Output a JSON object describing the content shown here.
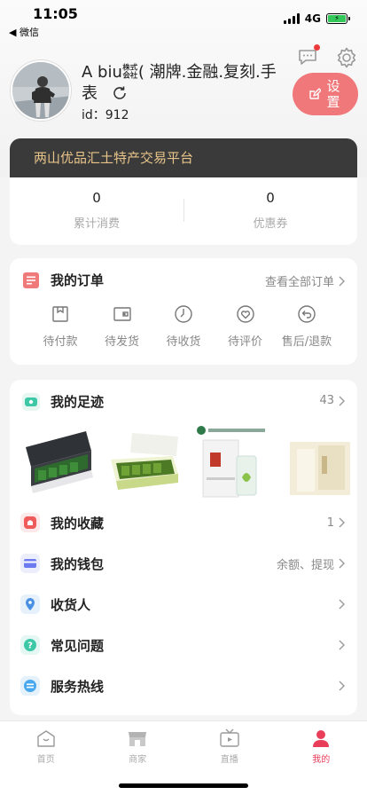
{
  "status": {
    "time": "11:05",
    "back_app": "◀ 微信",
    "network": "4G"
  },
  "profile": {
    "name": "A biu㍿( 潮牌.金融.复刻.手表",
    "id_label": "id：912",
    "settings_label": "设置"
  },
  "vip": {
    "banner": "两山优品汇土特产交易平台",
    "stats": [
      {
        "value": "0",
        "label": "累计消费"
      },
      {
        "value": "0",
        "label": "优惠券"
      }
    ]
  },
  "orders": {
    "title": "我的订单",
    "view_all": "查看全部订单",
    "items": [
      {
        "label": "待付款",
        "icon": "wallet-icon"
      },
      {
        "label": "待发货",
        "icon": "box-icon"
      },
      {
        "label": "待收货",
        "icon": "clock-icon"
      },
      {
        "label": "待评价",
        "icon": "heart-icon"
      },
      {
        "label": "售后/退款",
        "icon": "return-icon"
      }
    ]
  },
  "footprint": {
    "title": "我的足迹",
    "count": "43"
  },
  "menu": [
    {
      "label": "我的收藏",
      "right": "1",
      "icon": "favorites-icon",
      "color": "#ef5a5a"
    },
    {
      "label": "我的钱包",
      "right": "余额、提现",
      "icon": "wallet-card-icon",
      "color": "#6c7cf0"
    },
    {
      "label": "收货人",
      "right": "",
      "icon": "location-icon",
      "color": "#4a90e2"
    },
    {
      "label": "常见问题",
      "right": "",
      "icon": "question-icon",
      "color": "#3cc7a6"
    },
    {
      "label": "服务热线",
      "right": "",
      "icon": "service-icon",
      "color": "#4aa8ee"
    }
  ],
  "tabbar": [
    {
      "label": "首页",
      "icon": "home-icon",
      "active": false
    },
    {
      "label": "商家",
      "icon": "shop-icon",
      "active": false
    },
    {
      "label": "直播",
      "icon": "live-tv-icon",
      "active": false
    },
    {
      "label": "我的",
      "icon": "profile-icon",
      "active": true
    }
  ],
  "colors": {
    "accent": "#f0787a",
    "banner_bg": "#3a3a3a",
    "banner_text": "#e8c48a",
    "active_tab": "#e83e5a"
  }
}
